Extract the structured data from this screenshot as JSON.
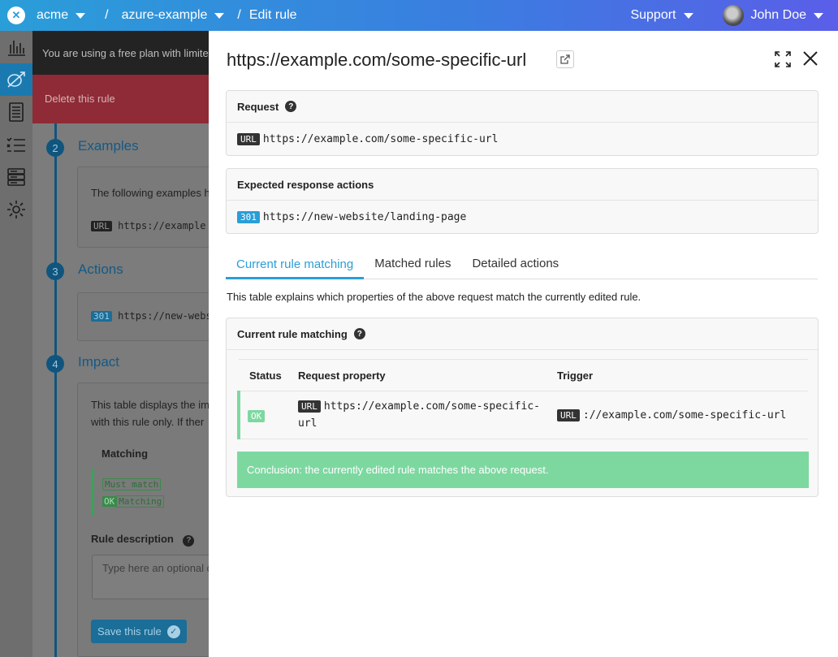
{
  "topbar": {
    "org": "acme",
    "project": "azure-example",
    "page": "Edit rule",
    "support": "Support",
    "user": "John Doe"
  },
  "sidebar": {
    "items": [
      {
        "icon": "bar-chart-icon"
      },
      {
        "icon": "rule-icon",
        "active": true
      },
      {
        "icon": "document-list-icon"
      },
      {
        "icon": "checklist-icon"
      },
      {
        "icon": "server-icon"
      },
      {
        "icon": "gear-icon"
      }
    ]
  },
  "background": {
    "banner": "You are using a free plan with limite",
    "delete_rule": "Delete this rule",
    "steps": [
      {
        "num": "2",
        "title": "Examples"
      },
      {
        "num": "3",
        "title": "Actions"
      },
      {
        "num": "4",
        "title": "Impact"
      }
    ],
    "examples_text": "The following examples h",
    "examples_tag": "URL",
    "examples_url": "https://example",
    "actions_tag": "301",
    "actions_url": "https://new-webs",
    "impact_line1": "This table displays the im",
    "impact_line2": "with this rule only. If ther",
    "matching_header": "Matching",
    "must_match": "Must match",
    "ok_tag": "OK",
    "matching": "Matching",
    "rule_description_label": "Rule description",
    "rule_description_placeholder": "Type here an optional d",
    "save_rule": "Save this rule"
  },
  "panel": {
    "title": "https://example.com/some-specific-url",
    "request": {
      "header": "Request",
      "tag": "URL",
      "url": "https://example.com/some-specific-url"
    },
    "expected": {
      "header": "Expected response actions",
      "tag": "301",
      "url": "https://new-website/landing-page"
    },
    "tabs": [
      {
        "label": "Current rule matching",
        "active": true
      },
      {
        "label": "Matched rules"
      },
      {
        "label": "Detailed actions"
      }
    ],
    "explanation": "This table explains which properties of the above request match the currently edited rule.",
    "matching_card": {
      "header": "Current rule matching",
      "columns": [
        "Status",
        "Request property",
        "Trigger"
      ],
      "row": {
        "status": "OK",
        "property_tag": "URL",
        "property_url_line1": "https://example.com/some-specific-",
        "property_url_line2": "url",
        "trigger_tag": "URL",
        "trigger_value": "://example.com/some-specific-url"
      },
      "conclusion": "Conclusion: the currently edited rule matches the above request."
    }
  },
  "colors": {
    "primary": "#2a9ed8",
    "success": "#7dd8a0",
    "danger_dimmed": "#8e2b36"
  }
}
